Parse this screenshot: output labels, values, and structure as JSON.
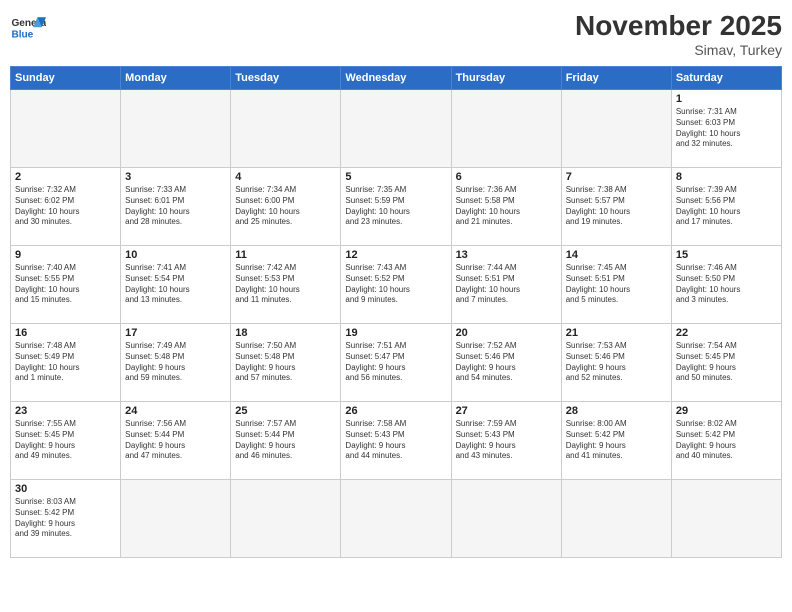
{
  "header": {
    "logo_general": "General",
    "logo_blue": "Blue",
    "month_title": "November 2025",
    "location": "Simav, Turkey"
  },
  "days_of_week": [
    "Sunday",
    "Monday",
    "Tuesday",
    "Wednesday",
    "Thursday",
    "Friday",
    "Saturday"
  ],
  "weeks": [
    [
      {
        "day": "",
        "info": ""
      },
      {
        "day": "",
        "info": ""
      },
      {
        "day": "",
        "info": ""
      },
      {
        "day": "",
        "info": ""
      },
      {
        "day": "",
        "info": ""
      },
      {
        "day": "",
        "info": ""
      },
      {
        "day": "1",
        "info": "Sunrise: 7:31 AM\nSunset: 6:03 PM\nDaylight: 10 hours\nand 32 minutes."
      }
    ],
    [
      {
        "day": "2",
        "info": "Sunrise: 7:32 AM\nSunset: 6:02 PM\nDaylight: 10 hours\nand 30 minutes."
      },
      {
        "day": "3",
        "info": "Sunrise: 7:33 AM\nSunset: 6:01 PM\nDaylight: 10 hours\nand 28 minutes."
      },
      {
        "day": "4",
        "info": "Sunrise: 7:34 AM\nSunset: 6:00 PM\nDaylight: 10 hours\nand 25 minutes."
      },
      {
        "day": "5",
        "info": "Sunrise: 7:35 AM\nSunset: 5:59 PM\nDaylight: 10 hours\nand 23 minutes."
      },
      {
        "day": "6",
        "info": "Sunrise: 7:36 AM\nSunset: 5:58 PM\nDaylight: 10 hours\nand 21 minutes."
      },
      {
        "day": "7",
        "info": "Sunrise: 7:38 AM\nSunset: 5:57 PM\nDaylight: 10 hours\nand 19 minutes."
      },
      {
        "day": "8",
        "info": "Sunrise: 7:39 AM\nSunset: 5:56 PM\nDaylight: 10 hours\nand 17 minutes."
      }
    ],
    [
      {
        "day": "9",
        "info": "Sunrise: 7:40 AM\nSunset: 5:55 PM\nDaylight: 10 hours\nand 15 minutes."
      },
      {
        "day": "10",
        "info": "Sunrise: 7:41 AM\nSunset: 5:54 PM\nDaylight: 10 hours\nand 13 minutes."
      },
      {
        "day": "11",
        "info": "Sunrise: 7:42 AM\nSunset: 5:53 PM\nDaylight: 10 hours\nand 11 minutes."
      },
      {
        "day": "12",
        "info": "Sunrise: 7:43 AM\nSunset: 5:52 PM\nDaylight: 10 hours\nand 9 minutes."
      },
      {
        "day": "13",
        "info": "Sunrise: 7:44 AM\nSunset: 5:51 PM\nDaylight: 10 hours\nand 7 minutes."
      },
      {
        "day": "14",
        "info": "Sunrise: 7:45 AM\nSunset: 5:51 PM\nDaylight: 10 hours\nand 5 minutes."
      },
      {
        "day": "15",
        "info": "Sunrise: 7:46 AM\nSunset: 5:50 PM\nDaylight: 10 hours\nand 3 minutes."
      }
    ],
    [
      {
        "day": "16",
        "info": "Sunrise: 7:48 AM\nSunset: 5:49 PM\nDaylight: 10 hours\nand 1 minute."
      },
      {
        "day": "17",
        "info": "Sunrise: 7:49 AM\nSunset: 5:48 PM\nDaylight: 9 hours\nand 59 minutes."
      },
      {
        "day": "18",
        "info": "Sunrise: 7:50 AM\nSunset: 5:48 PM\nDaylight: 9 hours\nand 57 minutes."
      },
      {
        "day": "19",
        "info": "Sunrise: 7:51 AM\nSunset: 5:47 PM\nDaylight: 9 hours\nand 56 minutes."
      },
      {
        "day": "20",
        "info": "Sunrise: 7:52 AM\nSunset: 5:46 PM\nDaylight: 9 hours\nand 54 minutes."
      },
      {
        "day": "21",
        "info": "Sunrise: 7:53 AM\nSunset: 5:46 PM\nDaylight: 9 hours\nand 52 minutes."
      },
      {
        "day": "22",
        "info": "Sunrise: 7:54 AM\nSunset: 5:45 PM\nDaylight: 9 hours\nand 50 minutes."
      }
    ],
    [
      {
        "day": "23",
        "info": "Sunrise: 7:55 AM\nSunset: 5:45 PM\nDaylight: 9 hours\nand 49 minutes."
      },
      {
        "day": "24",
        "info": "Sunrise: 7:56 AM\nSunset: 5:44 PM\nDaylight: 9 hours\nand 47 minutes."
      },
      {
        "day": "25",
        "info": "Sunrise: 7:57 AM\nSunset: 5:44 PM\nDaylight: 9 hours\nand 46 minutes."
      },
      {
        "day": "26",
        "info": "Sunrise: 7:58 AM\nSunset: 5:43 PM\nDaylight: 9 hours\nand 44 minutes."
      },
      {
        "day": "27",
        "info": "Sunrise: 7:59 AM\nSunset: 5:43 PM\nDaylight: 9 hours\nand 43 minutes."
      },
      {
        "day": "28",
        "info": "Sunrise: 8:00 AM\nSunset: 5:42 PM\nDaylight: 9 hours\nand 41 minutes."
      },
      {
        "day": "29",
        "info": "Sunrise: 8:02 AM\nSunset: 5:42 PM\nDaylight: 9 hours\nand 40 minutes."
      }
    ],
    [
      {
        "day": "30",
        "info": "Sunrise: 8:03 AM\nSunset: 5:42 PM\nDaylight: 9 hours\nand 39 minutes."
      },
      {
        "day": "",
        "info": ""
      },
      {
        "day": "",
        "info": ""
      },
      {
        "day": "",
        "info": ""
      },
      {
        "day": "",
        "info": ""
      },
      {
        "day": "",
        "info": ""
      },
      {
        "day": "",
        "info": ""
      }
    ]
  ]
}
